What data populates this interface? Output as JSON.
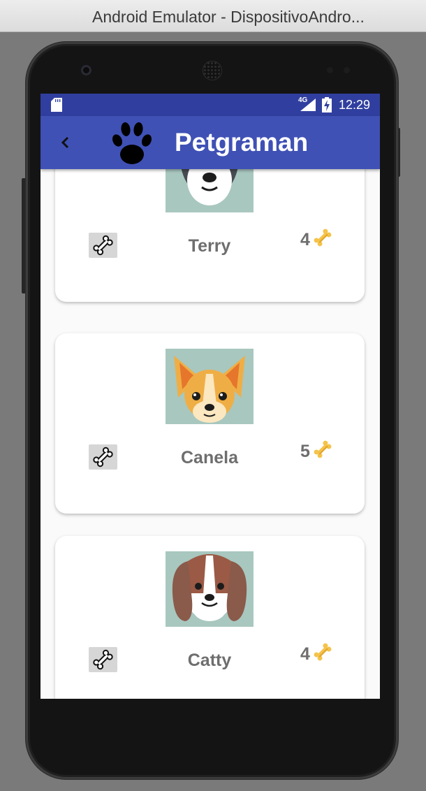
{
  "window": {
    "title": "Android Emulator - DispositivoAndro..."
  },
  "status_bar": {
    "network": "4G",
    "time": "12:29"
  },
  "app_bar": {
    "title": "Petgraman",
    "back_icon": "chevron-left-icon",
    "logo_icon": "paw-icon"
  },
  "pets": [
    {
      "name": "Terry",
      "likes": "4",
      "photo": "black-white-dog"
    },
    {
      "name": "Canela",
      "likes": "5",
      "photo": "chihuahua-dog"
    },
    {
      "name": "Catty",
      "likes": "4",
      "photo": "beagle-dog"
    }
  ],
  "colors": {
    "status_bar": "#303f9f",
    "app_bar": "#3f51b5",
    "photo_background": "#a8c7bf",
    "bone_gold": "#f5c34a"
  }
}
